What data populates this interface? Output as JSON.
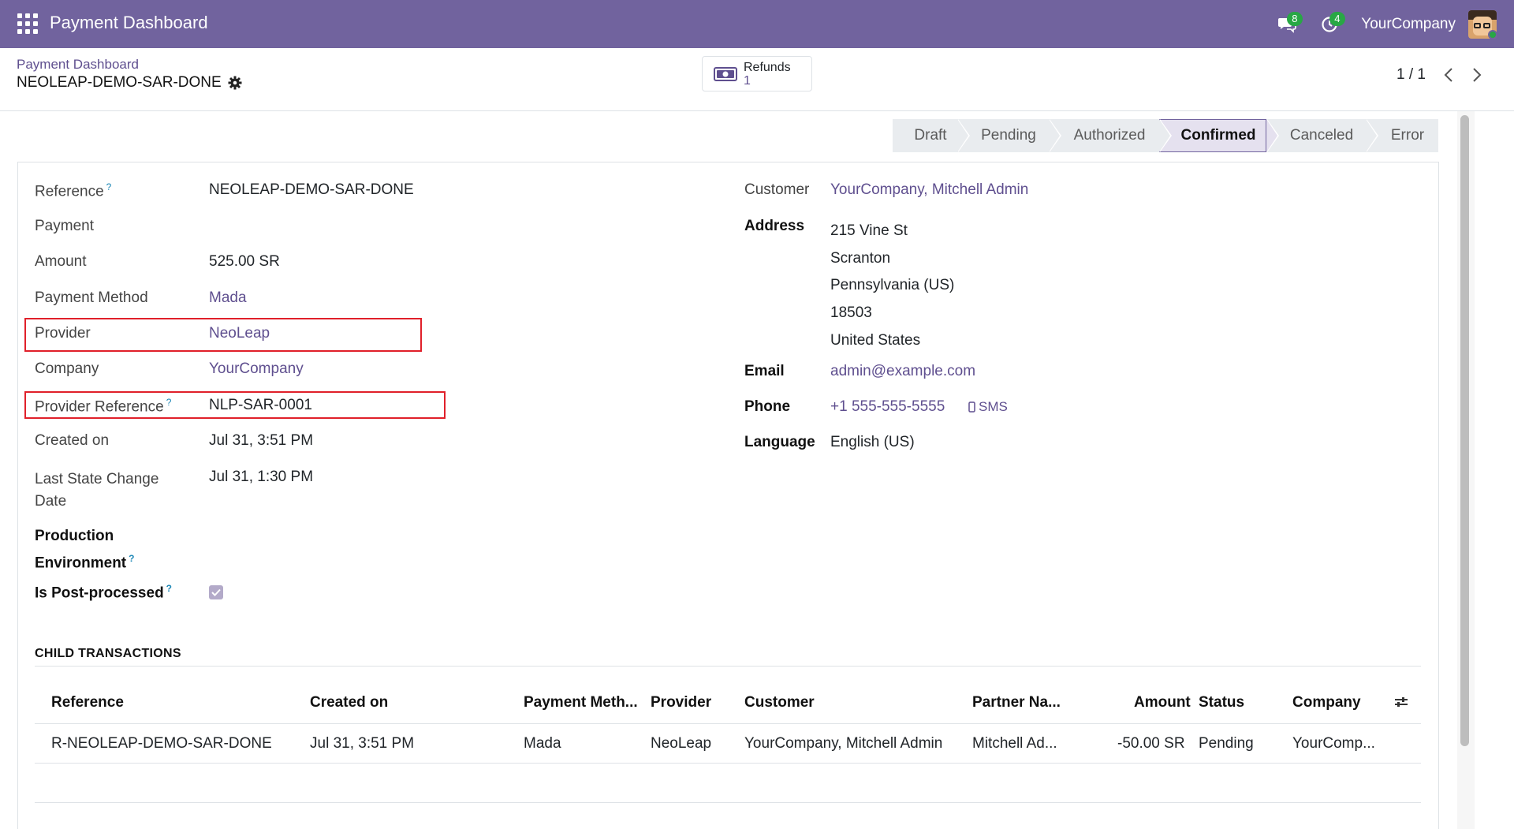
{
  "navbar": {
    "brand": "Payment Dashboard",
    "messages_count": "8",
    "activities_count": "4",
    "company": "YourCompany"
  },
  "control": {
    "breadcrumb": "Payment Dashboard",
    "record_name": "NEOLEAP-DEMO-SAR-DONE",
    "refunds_label": "Refunds",
    "refunds_count": "1",
    "pager": "1 / 1"
  },
  "statusbar": {
    "stages": [
      "Draft",
      "Pending",
      "Authorized",
      "Confirmed",
      "Canceled",
      "Error"
    ],
    "active": "Confirmed"
  },
  "left_fields": {
    "reference_label": "Reference",
    "reference_value": "NEOLEAP-DEMO-SAR-DONE",
    "payment_label": "Payment",
    "amount_label": "Amount",
    "amount_value": "525.00 SR",
    "payment_method_label": "Payment Method",
    "payment_method_value": "Mada",
    "provider_label": "Provider",
    "provider_value": "NeoLeap",
    "company_label": "Company",
    "company_value": "YourCompany",
    "provider_ref_label": "Provider Reference",
    "provider_ref_value": "NLP-SAR-0001",
    "created_label": "Created on",
    "created_value": "Jul 31, 3:51 PM",
    "last_state_label_1": "Last State Change",
    "last_state_label_2": "Date",
    "last_state_value": "Jul 31, 1:30 PM",
    "production_label_1": "Production",
    "production_label_2": "Environment",
    "post_processed_label": "Is Post-processed",
    "post_processed_checked": true
  },
  "right_fields": {
    "customer_label": "Customer",
    "customer_value": "YourCompany, Mitchell Admin",
    "address_label": "Address",
    "address_line1": "215 Vine St",
    "address_line2": "Scranton",
    "address_line3": "Pennsylvania (US)",
    "address_line4": "18503",
    "address_line5": "United States",
    "email_label": "Email",
    "email_value": "admin@example.com",
    "phone_label": "Phone",
    "phone_value": "+1 555-555-5555",
    "sms_label": "SMS",
    "language_label": "Language",
    "language_value": "English (US)"
  },
  "child_transactions": {
    "title": "CHILD TRANSACTIONS",
    "columns": [
      "Reference",
      "Created on",
      "Payment Meth...",
      "Provider",
      "Customer",
      "Partner Na...",
      "Amount",
      "Status",
      "Company"
    ],
    "rows": [
      [
        "R-NEOLEAP-DEMO-SAR-DONE",
        "Jul 31, 3:51 PM",
        "Mada",
        "NeoLeap",
        "YourCompany, Mitchell Admin",
        "Mitchell Ad...",
        "-50.00 SR",
        "Pending",
        "YourComp..."
      ]
    ]
  },
  "colors": {
    "navbar": "#71639e",
    "link": "#5f4f8f",
    "highlight_box": "#e0202a",
    "badge": "#28a745"
  },
  "icons": [
    "apps-grid-icon",
    "chat-icon",
    "clock-icon",
    "gear-icon",
    "money-icon",
    "chevron-left-icon",
    "chevron-right-icon",
    "check-icon",
    "mobile-icon",
    "column-settings-icon"
  ]
}
